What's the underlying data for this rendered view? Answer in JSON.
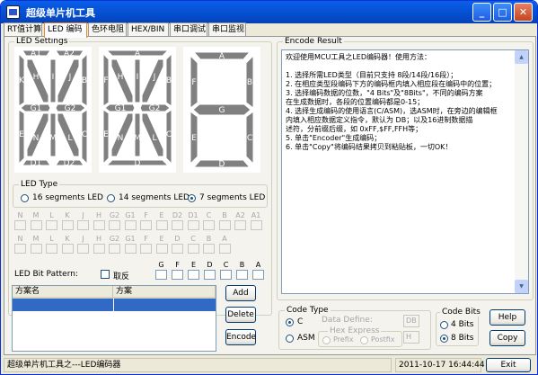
{
  "window": {
    "title": "超级单片机工具",
    "controls": {
      "minimize": "_",
      "maximize": "□",
      "close": "✕"
    }
  },
  "tabs": [
    {
      "label": "RT值计算",
      "active": false
    },
    {
      "label": "LED 编码",
      "active": true
    },
    {
      "label": "色环电阻",
      "active": false
    },
    {
      "label": "HEX/BIN",
      "active": false
    },
    {
      "label": "串口调试",
      "active": false
    },
    {
      "label": "串口监视",
      "active": false
    }
  ],
  "led_settings": {
    "label": "LED Settings",
    "display16": {
      "top": "A1",
      "top2": "A2",
      "ul": "B",
      "ur": "B",
      "segs": [
        "A1",
        "A2",
        "H",
        "I",
        "J",
        "K",
        "B",
        "G1",
        "G2",
        "N",
        "M",
        "L",
        "E",
        "C",
        "D1",
        "D2"
      ]
    },
    "display14": {
      "segs": [
        "A",
        "H",
        "I",
        "J",
        "F",
        "B",
        "G1",
        "G2",
        "N",
        "M",
        "L",
        "E",
        "C",
        "D"
      ]
    },
    "display7": {
      "segs": [
        "A",
        "F",
        "B",
        "G",
        "E",
        "C",
        "D"
      ]
    }
  },
  "led_type": {
    "label": "LED Type",
    "options": [
      {
        "label": "16 segments LED",
        "selected": false
      },
      {
        "label": "14 segments LED",
        "selected": false
      },
      {
        "label": "7 segments LED",
        "selected": true
      }
    ]
  },
  "bits16": [
    "N",
    "M",
    "L",
    "K",
    "J",
    "H",
    "G2",
    "G1",
    "F",
    "E",
    "D2",
    "D1",
    "C",
    "B",
    "A2",
    "A1"
  ],
  "bits14": [
    "N",
    "M",
    "L",
    "K",
    "J",
    "H",
    "G2",
    "G1",
    "F",
    "E",
    "D",
    "C",
    "B",
    "A"
  ],
  "bits7": [
    "G",
    "F",
    "E",
    "D",
    "C",
    "B",
    "A"
  ],
  "bit_pattern": {
    "label": "LED Bit Pattern:",
    "invert": "取反"
  },
  "scheme_table": {
    "columns": [
      "方案名",
      "方案"
    ]
  },
  "buttons": {
    "add": "Add",
    "delete": "Delete",
    "encode": "Encode",
    "help": "Help",
    "copy": "Copy",
    "exit": "Exit"
  },
  "encode_result": {
    "label": "Encode Result",
    "lines": [
      "欢迎使用MCU工具之LED编码器！使用方法：",
      "",
      "1. 选择所需LED类型（目前只支持 8段/14段/16段）；",
      "2. 在相应类型段编码下方的编码框内填入相应段在编码中的位置；",
      "3. 选择编码数据的位数，\"4 Bits\"及\"8Bits\"，不同的编码方案",
      "   在生成数据时，各段的位置编码都是0-15；",
      "4. 选择生成编码的使用语言(C/ASM)，选ASM时，在旁边的编辑框",
      "   内填入相应数据定义指令，默认为 DB；以及16进制数据描",
      "   述符，分前缀后缀，如 0xFF,$FF,FFH等；",
      "5. 单击\"Encoder\"生成编码；",
      "6. 单击\"Copy\"将编码结果拷贝到粘贴板，一切OK！"
    ]
  },
  "code_type": {
    "label": "Code Type",
    "options": [
      {
        "label": "C",
        "selected": true
      },
      {
        "label": "ASM",
        "selected": false
      }
    ],
    "data_define_label": "Data Define:",
    "data_define_value": "DB",
    "hex_express_label": "Hex Express",
    "hex_options": [
      "Prefix",
      "Postfix"
    ],
    "hex_value": "H"
  },
  "code_bits": {
    "label": "Code Bits",
    "options": [
      {
        "label": "4 Bits",
        "selected": false
      },
      {
        "label": "8 Bits",
        "selected": true
      }
    ]
  },
  "status": {
    "text": "超级单片机工具之---LED编码器",
    "datetime": "2011-10-17  16:44:44"
  }
}
